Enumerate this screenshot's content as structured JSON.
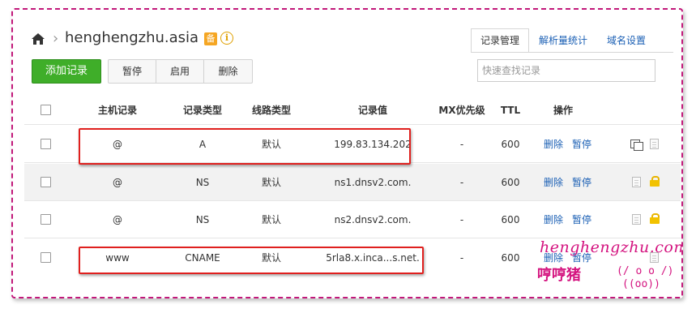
{
  "header": {
    "domain": "henghengzhu.asia",
    "badge": "备",
    "info": "i",
    "separator": "›"
  },
  "tabs": [
    {
      "label": "记录管理",
      "active": true
    },
    {
      "label": "解析量统计",
      "active": false
    },
    {
      "label": "域名设置",
      "active": false
    }
  ],
  "toolbar": {
    "add_label": "添加记录",
    "pause_label": "暂停",
    "enable_label": "启用",
    "delete_label": "删除",
    "search_placeholder": "快速查找记录"
  },
  "table": {
    "columns": [
      "主机记录",
      "记录类型",
      "线路类型",
      "记录值",
      "MX优先级",
      "TTL",
      "操作"
    ],
    "rows": [
      {
        "host": "@",
        "type": "A",
        "line": "默认",
        "value": "199.83.134.202",
        "mx": "-",
        "ttl": "600",
        "delete": "删除",
        "pause": "暂停",
        "icons": [
          "copy-icon",
          "note-icon"
        ]
      },
      {
        "host": "@",
        "type": "NS",
        "line": "默认",
        "value": "ns1.dnsv2.com.",
        "mx": "-",
        "ttl": "600",
        "delete": "删除",
        "pause": "暂停",
        "icons": [
          "note-icon",
          "lock-icon"
        ]
      },
      {
        "host": "@",
        "type": "NS",
        "line": "默认",
        "value": "ns2.dnsv2.com.",
        "mx": "-",
        "ttl": "600",
        "delete": "删除",
        "pause": "暂停",
        "icons": [
          "note-icon",
          "lock-icon"
        ]
      },
      {
        "host": "www",
        "type": "CNAME",
        "line": "默认",
        "value": "5rla8.x.inca...s.net.",
        "mx": "-",
        "ttl": "600",
        "delete": "删除",
        "pause": "暂停",
        "icons": [
          "note-icon"
        ]
      }
    ]
  },
  "watermark": {
    "line1": "henghengzhu.com",
    "line2": "哼哼猪",
    "face1": "(/ o o /)",
    "face2": "((oo))"
  },
  "colors": {
    "brand_green": "#3fae29",
    "link_blue": "#1a5fb4",
    "highlight_red": "#e0201e",
    "border_magenta": "#c2187a"
  }
}
